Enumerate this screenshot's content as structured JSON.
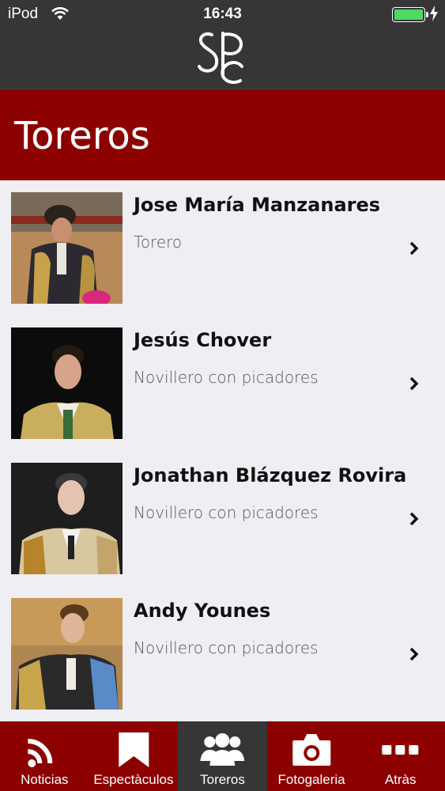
{
  "status_bar": {
    "carrier": "iPod",
    "time": "16:43"
  },
  "header": {
    "logo_icon": "spc-monogram-logo"
  },
  "page": {
    "title": "Toreros"
  },
  "colors": {
    "brand_red": "#8c0000",
    "dark_bar": "#363636",
    "battery_green": "#4cd964"
  },
  "toreros": [
    {
      "name": "Jose María Manzanares",
      "role": "Torero"
    },
    {
      "name": "Jesús Chover",
      "role": "Novillero con picadores"
    },
    {
      "name": "Jonathan Blázquez Rovira",
      "role": "Novillero con picadores"
    },
    {
      "name": "Andy Younes",
      "role": "Novillero con picadores"
    }
  ],
  "tabs": [
    {
      "label": "Noticias",
      "icon": "rss-icon"
    },
    {
      "label": "Espectàculos",
      "icon": "bookmark-icon"
    },
    {
      "label": "Toreros",
      "icon": "people-icon",
      "active": true
    },
    {
      "label": "Fotogaleria",
      "icon": "camera-icon"
    },
    {
      "label": "Atràs",
      "icon": "more-dots-icon"
    }
  ]
}
